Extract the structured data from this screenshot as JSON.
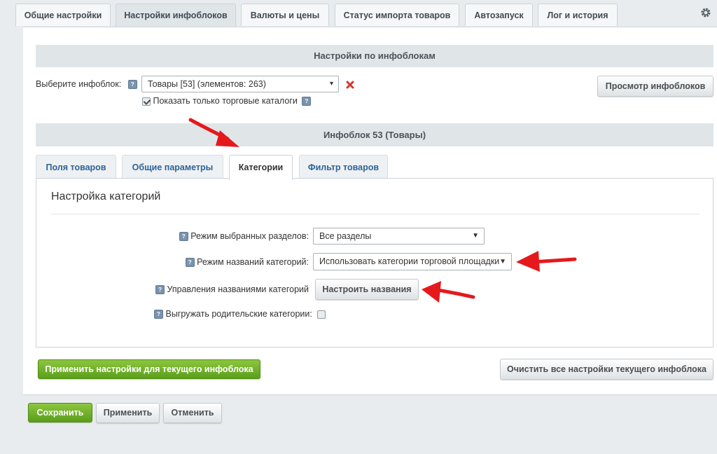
{
  "top_tabs": [
    "Общие настройки",
    "Настройки инфоблоков",
    "Валюты и цены",
    "Статус импорта товаров",
    "Автозапуск",
    "Лог и история"
  ],
  "section_title": "Настройки по инфоблокам",
  "iblock_select": {
    "label": "Выберите инфоблок:",
    "value": "Товары [53] (элементов: 263)",
    "show_only_catalogs": "Показать только торговые каталоги",
    "show_only_catalogs_checked": true
  },
  "view_iblocks_button": "Просмотр инфоблоков",
  "iblock_title": "Инфоблок 53 (Товары)",
  "sub_tabs": [
    "Поля товаров",
    "Общие параметры",
    "Категории",
    "Фильтр товаров"
  ],
  "categories": {
    "heading": "Настройка категорий",
    "section_mode_label": "Режим выбранных разделов:",
    "section_mode_value": "Все разделы",
    "names_mode_label": "Режим названий категорий:",
    "names_mode_value": "Использовать категории торговой площадки",
    "names_manage_label": "Управления названиями категорий",
    "names_manage_button": "Настроить названия",
    "export_parents_label": "Выгружать родительские категории:",
    "export_parents_checked": false
  },
  "apply_current_button": "Применить настройки для текущего инфоблока",
  "clear_current_button": "Очистить все настройки текущего инфоблока",
  "footer": {
    "save": "Сохранить",
    "apply": "Применить",
    "cancel": "Отменить"
  },
  "colors": {
    "accent_green": "#6aad26",
    "tab_link": "#2f6296",
    "annotation_arrow": "#e5191c",
    "delete_x": "#d9342b"
  }
}
